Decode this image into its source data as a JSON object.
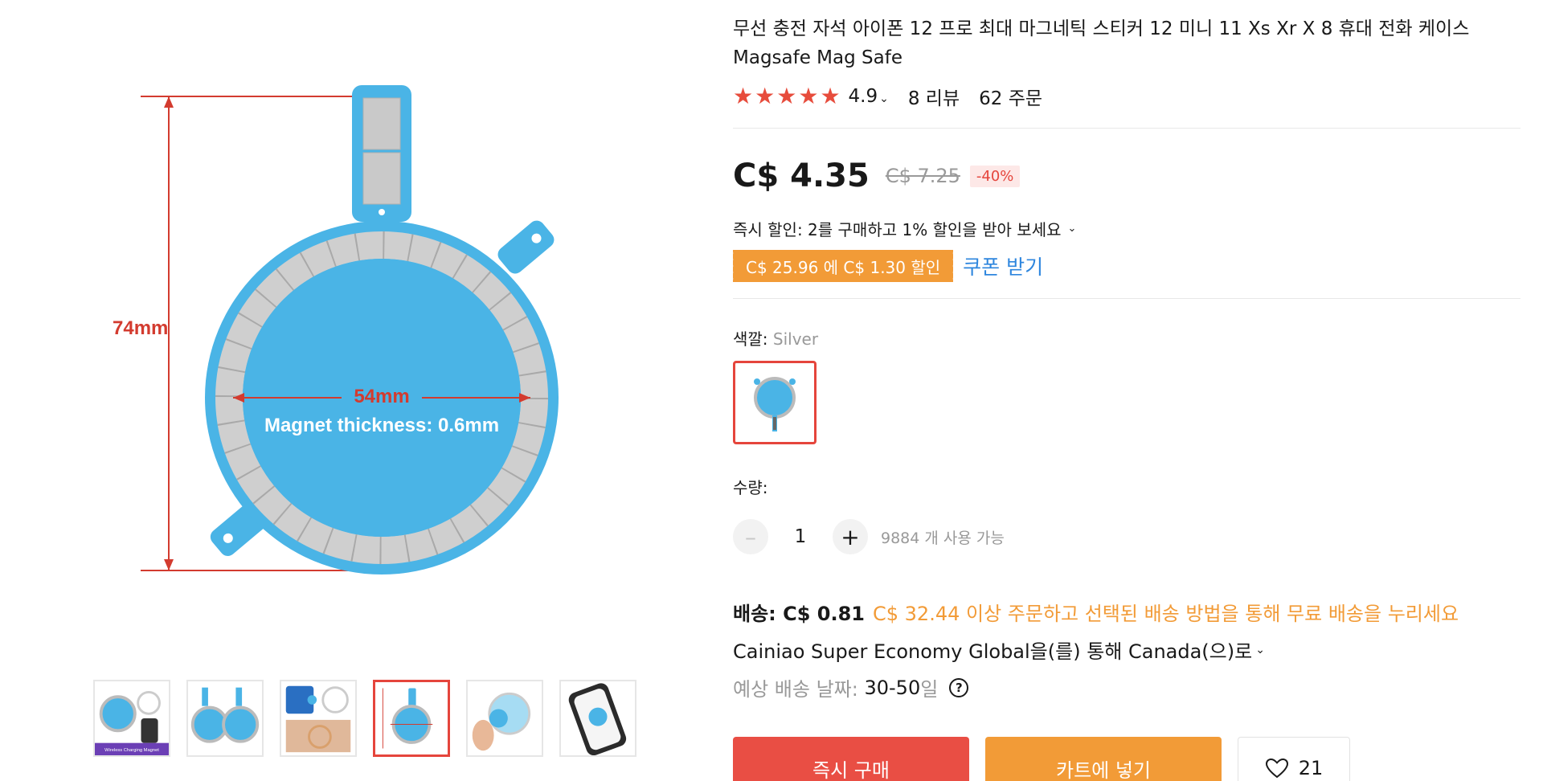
{
  "gallery": {
    "main_labels": {
      "height": "74mm",
      "width": "54mm",
      "thickness": "Magnet thickness: 0.6mm"
    },
    "thumbs": [
      {
        "label": "Wireless Charging Magnet"
      },
      {
        "label": ""
      },
      {
        "label": ""
      },
      {
        "label": ""
      },
      {
        "label": ""
      },
      {
        "label": ""
      }
    ],
    "active_thumb_index": 3
  },
  "product": {
    "title": "무선 충전 자석 아이폰 12 프로 최대 마그네틱 스티커 12 미니 11 Xs Xr X 8 휴대 전화 케이스 Magsafe Mag Safe",
    "rating": "4.9",
    "rating_stars": 5,
    "reviews": "8 리뷰",
    "orders": "62 주문"
  },
  "price": {
    "current": "C$ 4.35",
    "original": "C$ 7.25",
    "discount": "-40%"
  },
  "promo": {
    "instant_discount": "즉시 할인: 2를 구매하고 1% 할인을 받아 보세요",
    "coupon_text": "C$ 25.96 에 C$ 1.30 할인",
    "coupon_link": "쿠폰 받기"
  },
  "color": {
    "label": "색깔:",
    "value": "Silver"
  },
  "quantity": {
    "label": "수량:",
    "minus": "–",
    "value": "1",
    "plus": "+",
    "available": "9884 개 사용 가능"
  },
  "shipping": {
    "label": "배송: C$ 0.81",
    "free_note": "C$ 32.44 이상 주문하고 선택된 배송 방법을 통해 무료 배송을 누리세요",
    "method": "Cainiao Super Economy Global을(를) 통해 Canada(으)로",
    "eta_label": "예상 배송 날짜:",
    "eta_value": "30-50",
    "eta_unit": "일"
  },
  "actions": {
    "buy_now": "즉시 구매",
    "add_to_cart": "카트에 넣기",
    "wishlist_count": "21"
  },
  "colors": {
    "accent_red": "#e94e44",
    "accent_orange": "#f29b37",
    "link_blue": "#2e86de",
    "magnet_blue": "#4ab4e6"
  }
}
